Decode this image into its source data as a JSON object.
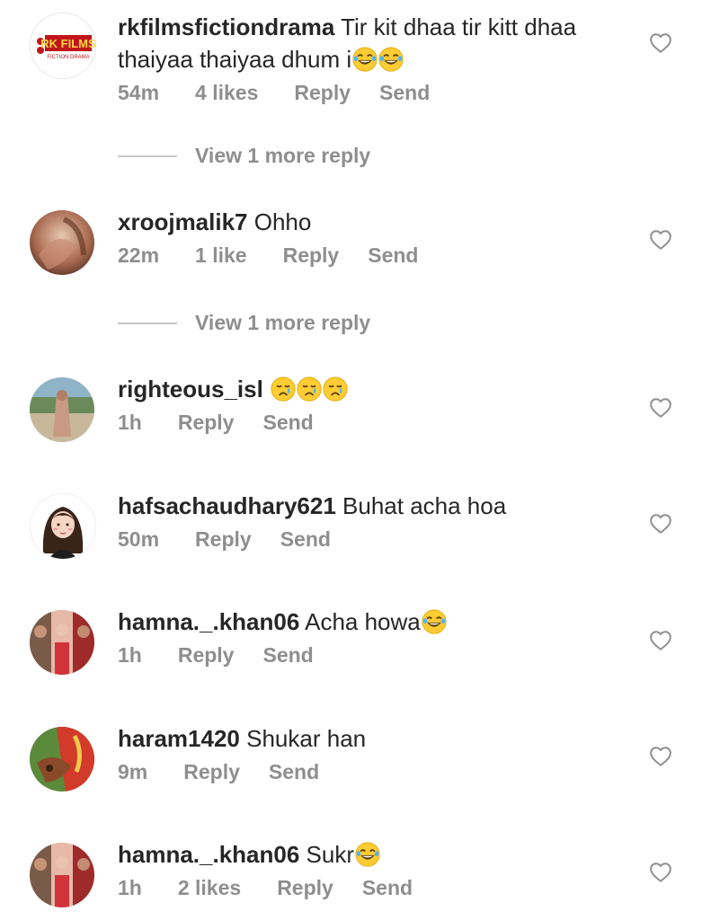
{
  "comments": [
    {
      "username": "rkfilmsfictiondrama",
      "text": "Tir kit dhaa tir kitt dhaa thaiyaa thaiyaa dhum i",
      "emojis": [
        "laughing-tears",
        "laughing-tears"
      ],
      "time": "54m",
      "likes": "4 likes",
      "reply": "Reply",
      "send": "Send",
      "avatar_label_top": "RK FILMS",
      "avatar_label_bottom": "FICTION DRAMA"
    },
    {
      "username": "xroojmalik7",
      "text": "Ohho",
      "time": "22m",
      "likes": "1 like",
      "reply": "Reply",
      "send": "Send"
    },
    {
      "username": "righteous_isl",
      "text": "",
      "emojis": [
        "crying",
        "crying",
        "crying"
      ],
      "time": "1h",
      "reply": "Reply",
      "send": "Send"
    },
    {
      "username": "hafsachaudhary621",
      "text": "Buhat acha hoa",
      "time": "50m",
      "reply": "Reply",
      "send": "Send"
    },
    {
      "username": "hamna._.khan06",
      "text": "Acha howa",
      "emojis": [
        "laughing-tears"
      ],
      "time": "1h",
      "reply": "Reply",
      "send": "Send"
    },
    {
      "username": "haram1420",
      "text": "Shukar han",
      "time": "9m",
      "reply": "Reply",
      "send": "Send"
    },
    {
      "username": "hamna._.khan06",
      "text": "Sukr",
      "emojis": [
        "laughing-tears"
      ],
      "time": "1h",
      "likes": "2 likes",
      "reply": "Reply",
      "send": "Send"
    }
  ],
  "view_more_replies": [
    "View 1 more reply",
    "View 1 more reply"
  ],
  "icons": {
    "like": "heart-outline-icon",
    "laughing": "face-with-tears-of-joy-emoji",
    "crying": "crying-face-emoji"
  },
  "colors": {
    "text": "#262626",
    "meta": "#8e8e8e",
    "divider": "#c7c7c7",
    "brand_red": "#c0161b"
  }
}
